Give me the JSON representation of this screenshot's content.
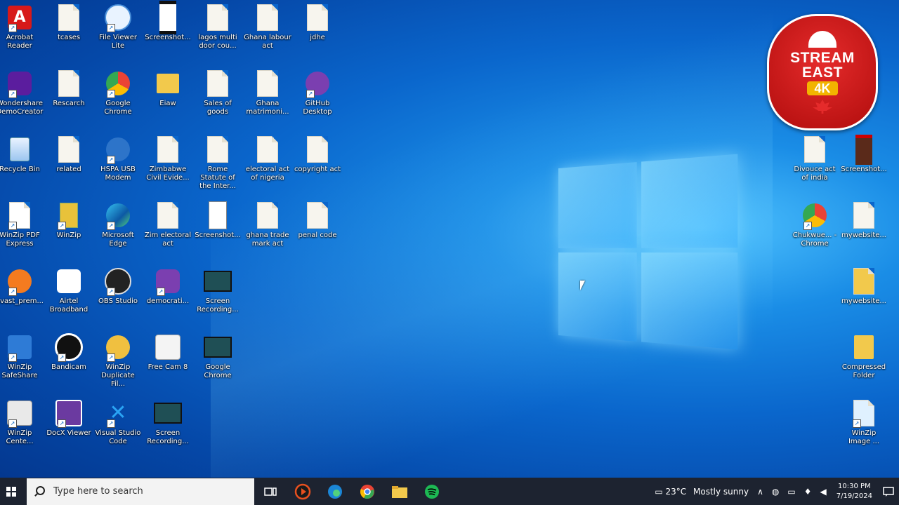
{
  "desktop": {
    "icons": [
      {
        "label": "Acrobat Reader"
      },
      {
        "label": "tcases"
      },
      {
        "label": "File Viewer Lite"
      },
      {
        "label": "Screenshot..."
      },
      {
        "label": "lagos multi door cou..."
      },
      {
        "label": "Ghana labour act"
      },
      {
        "label": "jdhe"
      },
      {
        "label": "Wondershare DemoCreator"
      },
      {
        "label": "Rescarch"
      },
      {
        "label": "Google Chrome"
      },
      {
        "label": "Eiaw"
      },
      {
        "label": "Sales of goods"
      },
      {
        "label": "Ghana matrimoni..."
      },
      {
        "label": "GitHub Desktop"
      },
      {
        "label": "Recycle Bin"
      },
      {
        "label": "related"
      },
      {
        "label": "HSPA USB Modem"
      },
      {
        "label": "Zimbabwe Civil Evide..."
      },
      {
        "label": "Rome Statute of the Inter..."
      },
      {
        "label": "electoral act of nigeria"
      },
      {
        "label": "copyright act"
      },
      {
        "label": "WinZip PDF Express"
      },
      {
        "label": "WinZip"
      },
      {
        "label": "Microsoft Edge"
      },
      {
        "label": "Zim electoral act"
      },
      {
        "label": "Screenshot..."
      },
      {
        "label": "ghana trade mark act"
      },
      {
        "label": "penal code"
      },
      {
        "label": "avast_prem..."
      },
      {
        "label": "Airtel Broadband"
      },
      {
        "label": "OBS Studio"
      },
      {
        "label": "democrati..."
      },
      {
        "label": "Screen Recording..."
      },
      {
        "label": "WinZip SafeShare"
      },
      {
        "label": "Bandicam"
      },
      {
        "label": "WinZip Duplicate Fil..."
      },
      {
        "label": "Free Cam 8"
      },
      {
        "label": "Google Chrome"
      },
      {
        "label": "WinZip Cente..."
      },
      {
        "label": "DocX Viewer"
      },
      {
        "label": "Visual Studio Code"
      },
      {
        "label": "Screen Recording..."
      },
      {
        "label": "Divouce act of india"
      },
      {
        "label": "Screenshot..."
      },
      {
        "label": "Chukwue... - Chrome"
      },
      {
        "label": "mywebsite..."
      },
      {
        "label": "mywebsite..."
      },
      {
        "label": "Compressed Folder"
      },
      {
        "label": "WinZip Image ..."
      }
    ]
  },
  "badge": {
    "line1": "STREAM",
    "line2": "EAST",
    "line3": "4K"
  },
  "taskbar": {
    "search_placeholder": "Type here to search",
    "weather_temp": "23°C",
    "weather_text": "Mostly sunny",
    "time": "10:30 PM",
    "date": "7/19/2024"
  }
}
